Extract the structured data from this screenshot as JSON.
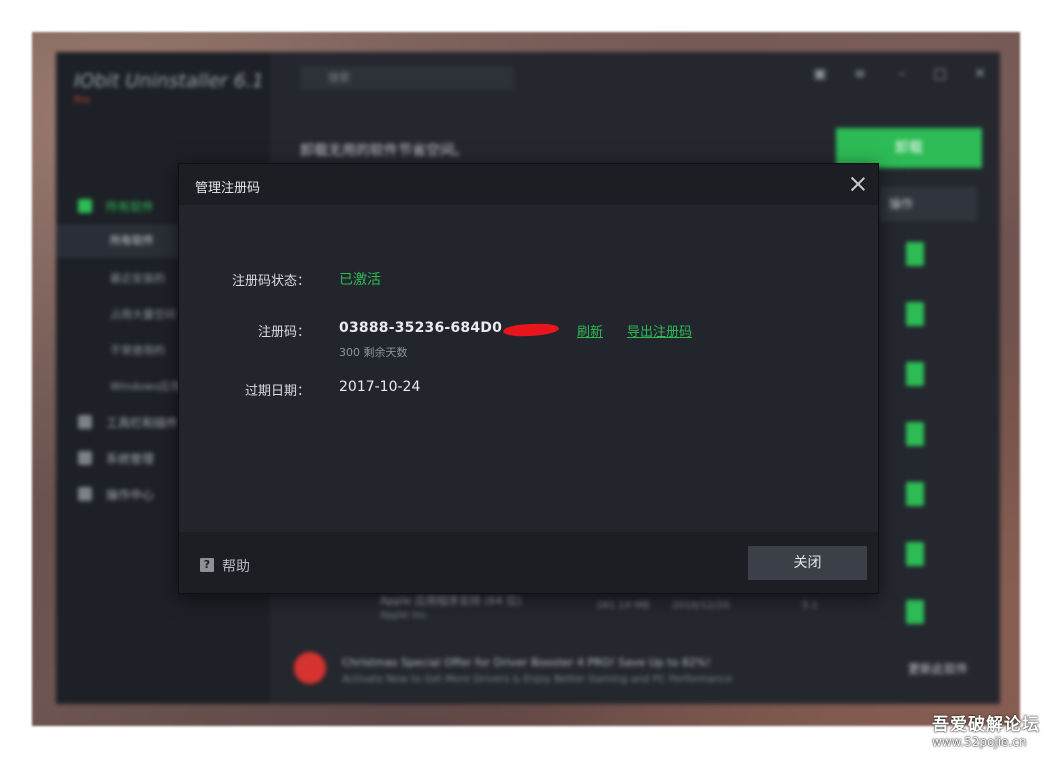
{
  "background_app": {
    "title": "IObit Uninstaller 6.1",
    "edition": "Pro",
    "search_placeholder": "搜索",
    "headline": "卸载无用的软件节省空间。",
    "uninstall_button": "卸载",
    "column_header": "操作",
    "sidebar": {
      "items": [
        {
          "label": "所有软件",
          "icon": "grid-icon",
          "active": true
        },
        {
          "label": "工具栏和插件",
          "icon": "puzzle-icon"
        },
        {
          "label": "系统管理",
          "icon": "windows-icon"
        },
        {
          "label": "操作中心",
          "icon": "flag-icon"
        }
      ],
      "subitems": [
        "所有软件",
        "最近安装的",
        "占用大量空间",
        "不常使用的",
        "Windows应用"
      ]
    },
    "row": {
      "name": "Apple 应用程序支持 (64 位)",
      "publisher": "Apple Inc.",
      "size": "161.14 MB",
      "date": "2016/12/20",
      "version": "5.1"
    },
    "promo": {
      "title": "Christmas Special Offer for Driver Booster 4 PRO! Save Up to 82%!",
      "subtitle": "Activate Now to Get More Drivers & Enjoy Better Gaming and PC Performance",
      "link": "更新此软件"
    },
    "accent": "#2dbb55"
  },
  "dialog": {
    "title": "管理注册码",
    "status_label": "注册码状态：",
    "status_value": "已激活",
    "code_label": "注册码：",
    "code_value": "03888-35236-684D0",
    "days_left": "300 剩余天数",
    "refresh_link": "刷新",
    "export_link": "导出注册码",
    "expiry_label": "过期日期：",
    "expiry_value": "2017-10-24",
    "help_label": "帮助",
    "close_button": "关闭",
    "status_color": "#2dbb55"
  },
  "watermark": {
    "name": "吾爱破解论坛",
    "url": "www.52pojie.cn"
  }
}
